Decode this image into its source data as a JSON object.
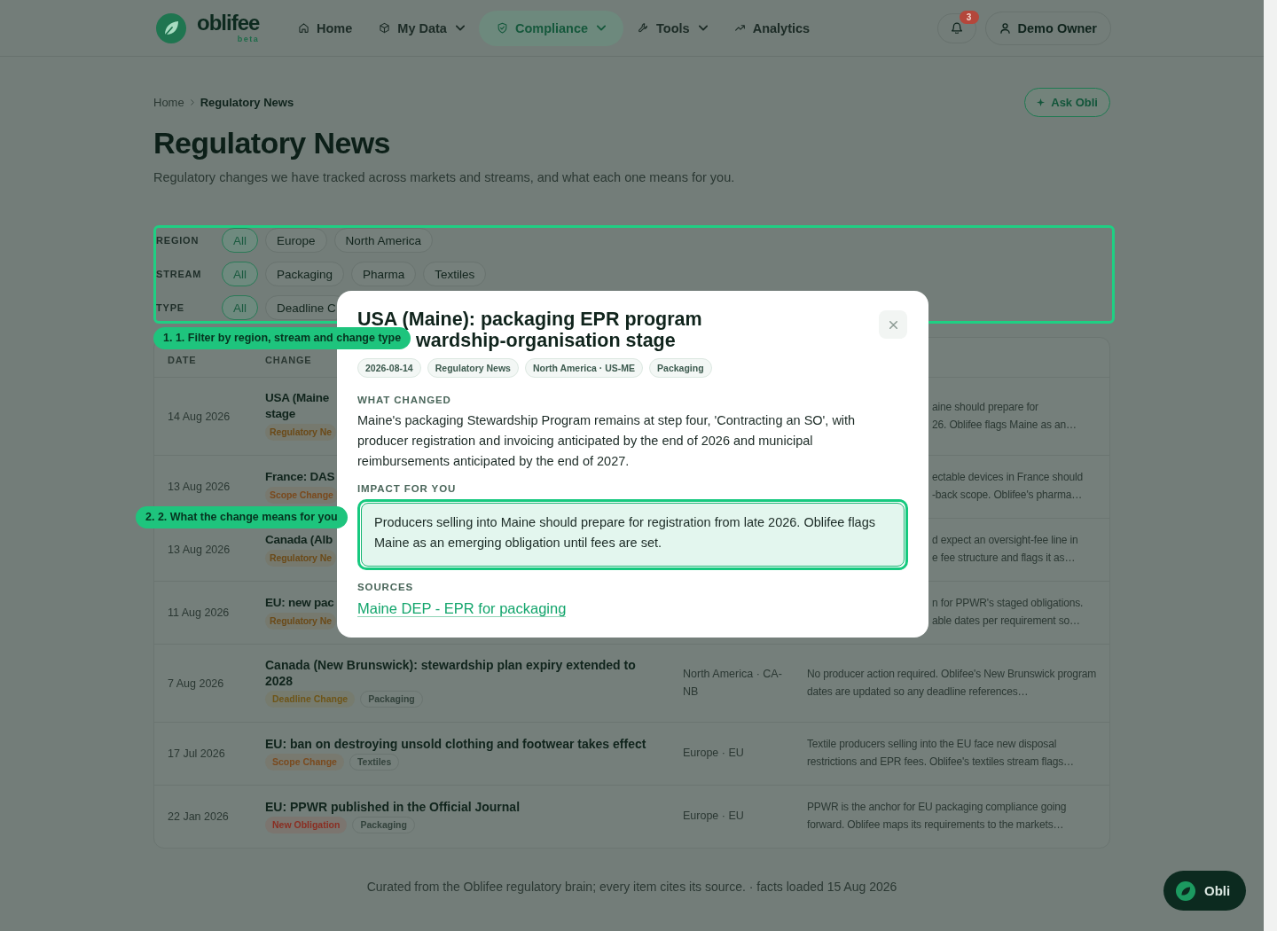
{
  "header": {
    "logo": {
      "wordmark": "oblifee",
      "tagline": "beta"
    },
    "nav": [
      {
        "label": "Home",
        "dropdown": false,
        "selected": false
      },
      {
        "label": "My Data",
        "dropdown": true,
        "selected": false
      },
      {
        "label": "Compliance",
        "dropdown": true,
        "selected": true
      },
      {
        "label": "Tools",
        "dropdown": true,
        "selected": false
      },
      {
        "label": "Analytics",
        "dropdown": false,
        "selected": false
      }
    ],
    "notifications": {
      "count": "3"
    },
    "user": {
      "name": "Demo Owner"
    }
  },
  "breadcrumb": [
    {
      "label": "Home",
      "current": false
    },
    {
      "label": "Regulatory News",
      "current": true
    }
  ],
  "ask_button": {
    "label": "Ask Obli"
  },
  "page": {
    "title": "Regulatory News",
    "subtitle": "Regulatory changes we have tracked across markets and streams, and what each one means for you."
  },
  "filters": [
    {
      "label": "REGION",
      "options": [
        {
          "label": "All",
          "selected": true
        },
        {
          "label": "Europe",
          "selected": false
        },
        {
          "label": "North America",
          "selected": false
        }
      ]
    },
    {
      "label": "STREAM",
      "options": [
        {
          "label": "All",
          "selected": true
        },
        {
          "label": "Packaging",
          "selected": false
        },
        {
          "label": "Pharma",
          "selected": false
        },
        {
          "label": "Textiles",
          "selected": false
        }
      ]
    },
    {
      "label": "TYPE",
      "options": [
        {
          "label": "All",
          "selected": true
        },
        {
          "label": "Deadline C",
          "selected": false
        }
      ]
    }
  ],
  "table": {
    "columns": [
      "DATE",
      "CHANGE"
    ],
    "rows": [
      {
        "date": "14 Aug 2026",
        "kind": "covered",
        "title_lines": [
          "USA (Maine",
          "stage"
        ],
        "tags": [
          {
            "label": "Regulatory Ne",
            "kind": "type",
            "color": "#6b4a18"
          }
        ],
        "impact_lines": [
          "aine should prepare for",
          "26. Oblifee flags Maine as an…"
        ]
      },
      {
        "date": "13 Aug 2026",
        "kind": "covered",
        "title_lines": [
          "France: DAS"
        ],
        "tags": [
          {
            "label": "Scope Change",
            "kind": "type",
            "color": "#7a4a1e"
          }
        ],
        "impact_lines": [
          "ectable devices in France should",
          "-back scope. Oblifee's pharma…"
        ]
      },
      {
        "date": "13 Aug 2026",
        "kind": "covered",
        "title_lines": [
          "Canada (Alb"
        ],
        "tags": [
          {
            "label": "Regulatory Ne",
            "kind": "type",
            "color": "#6b4a18"
          }
        ],
        "impact_lines": [
          "d expect an oversight-fee line in",
          "e fee structure and flags it as…"
        ]
      },
      {
        "date": "11 Aug 2026",
        "kind": "covered",
        "title_lines": [
          "EU: new pac"
        ],
        "tags": [
          {
            "label": "Regulatory Ne",
            "kind": "type",
            "color": "#6b4a18"
          }
        ],
        "impact_lines": [
          "n for PPWR's staged obligations.",
          "able dates per requirement so…"
        ]
      },
      {
        "date": "7 Aug 2026",
        "kind": "full",
        "title_lines": [
          "Canada (New Brunswick): stewardship plan expiry extended to 2028"
        ],
        "tags": [
          {
            "label": "Deadline Change",
            "kind": "type",
            "color": "#6e5518"
          },
          {
            "label": "Packaging",
            "kind": "stream"
          }
        ],
        "region": "North America · CA-NB",
        "impact_lines": [
          "No producer action required. Oblifee's New Brunswick program dates are updated so any deadline references…"
        ]
      },
      {
        "date": "17 Jul 2026",
        "kind": "full",
        "title_lines": [
          "EU: ban on destroying unsold clothing and footwear takes effect"
        ],
        "tags": [
          {
            "label": "Scope Change",
            "kind": "type",
            "color": "#7a4a1e"
          },
          {
            "label": "Textiles",
            "kind": "stream"
          }
        ],
        "region": "Europe · EU",
        "impact_lines": [
          "Textile producers selling into the EU face new disposal restrictions and EPR fees. Oblifee's textiles stream flags…"
        ]
      },
      {
        "date": "22 Jan 2026",
        "kind": "full",
        "title_lines": [
          "EU: PPWR published in the Official Journal"
        ],
        "tags": [
          {
            "label": "New Obligation",
            "kind": "type",
            "color": "#8a2e22"
          },
          {
            "label": "Packaging",
            "kind": "stream"
          }
        ],
        "region": "Europe · EU",
        "impact_lines": [
          "PPWR is the anchor for EU packaging compliance going forward. Oblifee maps its requirements to the markets…"
        ]
      }
    ]
  },
  "footer": {
    "note": "Curated from the Oblifee regulatory brain; every item cites its source. · facts loaded 15 Aug 2026"
  },
  "assistant_button": {
    "label": "Obli"
  },
  "dialog": {
    "title_lines": [
      "USA (Maine): packaging EPR program",
      "wardship-organisation stage"
    ],
    "tags": [
      "2026-08-14",
      "Regulatory News",
      "North America · US-ME",
      "Packaging"
    ],
    "sections": [
      {
        "heading": "WHAT CHANGED",
        "kind": "text",
        "body": "Maine's packaging Stewardship Program remains at step four, 'Contracting an SO', with producer registration and invoicing anticipated by the end of 2026 and municipal reimbursements anticipated by the end of 2027."
      },
      {
        "heading": "IMPACT FOR YOU",
        "kind": "highlight",
        "body": "Producers selling into Maine should prepare for registration from late 2026. Oblifee flags Maine as an emerging obligation until fees are set."
      },
      {
        "heading": "SOURCES",
        "kind": "links",
        "links": [
          "Maine DEP - EPR for packaging"
        ]
      }
    ]
  },
  "tour": {
    "steps": [
      "1. 1. Filter by region, stream and change type",
      "2. 2. What the change means for you"
    ]
  }
}
